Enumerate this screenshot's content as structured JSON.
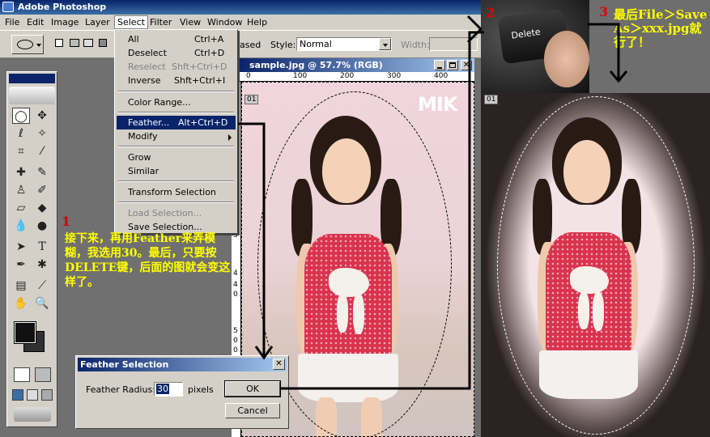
{
  "app": {
    "title": "Adobe Photoshop"
  },
  "menubar": [
    "File",
    "Edit",
    "Image",
    "Layer",
    "Select",
    "Filter",
    "View",
    "Window",
    "Help"
  ],
  "options": {
    "feather_label_partial": "ased",
    "style_label": "Style:",
    "style_value": "Normal",
    "width_label": "Width:"
  },
  "select_menu": {
    "items": [
      {
        "label": "All",
        "shortcut": "Ctrl+A",
        "enabled": true
      },
      {
        "label": "Deselect",
        "shortcut": "Ctrl+D",
        "enabled": true
      },
      {
        "label": "Reselect",
        "shortcut": "Shft+Ctrl+D",
        "enabled": false
      },
      {
        "label": "Inverse",
        "shortcut": "Shft+Ctrl+I",
        "enabled": true
      },
      {
        "label": "Color Range...",
        "shortcut": "",
        "enabled": true
      },
      {
        "label": "Feather...",
        "shortcut": "Alt+Ctrl+D",
        "enabled": true,
        "highlighted": true
      },
      {
        "label": "Modify",
        "shortcut": "",
        "enabled": true,
        "submenu": true
      },
      {
        "label": "Grow",
        "shortcut": "",
        "enabled": true
      },
      {
        "label": "Similar",
        "shortcut": "",
        "enabled": true
      },
      {
        "label": "Transform Selection",
        "shortcut": "",
        "enabled": true
      },
      {
        "label": "Load Selection...",
        "shortcut": "",
        "enabled": false
      },
      {
        "label": "Save Selection...",
        "shortcut": "",
        "enabled": true
      }
    ]
  },
  "document": {
    "title": "sample.jpg @ 57.7% (RGB)",
    "ruler_ticks": [
      "0",
      "100",
      "200",
      "300",
      "400"
    ],
    "side_ruler": [
      "3",
      "4",
      "4",
      "0",
      "5",
      "0",
      "0"
    ],
    "slice_badge": "01",
    "watermark": "MIK"
  },
  "annotations": {
    "step1_number": "1",
    "step1_text": "接下来，再用Feather来弄模糊，我选用30。最后，只要按DELETE键，后面的图就会变这样了。",
    "step2_number": "2",
    "step3_number": "3",
    "step3_text": "最后File＞Save As＞xxx.jpg就行了！",
    "key_label": "Delete"
  },
  "feather_dialog": {
    "title": "Feather Selection",
    "radius_label": "Feather Radius:",
    "radius_value": "30",
    "unit": "pixels",
    "ok_label": "OK",
    "cancel_label": "Cancel"
  },
  "right_image": {
    "slice_badge": "01"
  }
}
